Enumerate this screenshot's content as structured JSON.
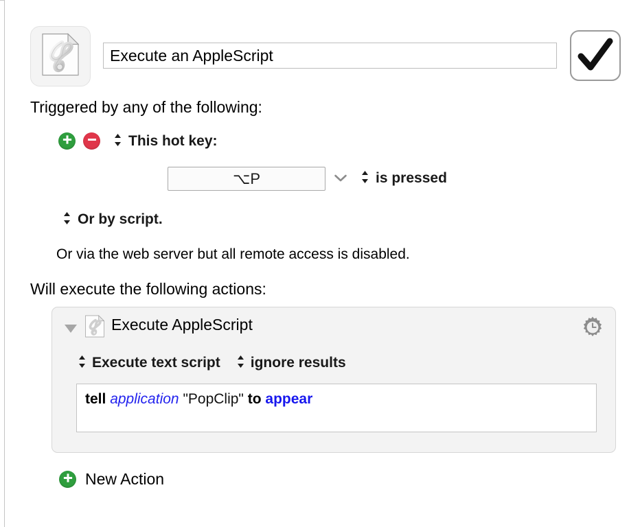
{
  "window": {
    "macro_title": "Execute an AppleScript",
    "macro_title_placeholder": "Macro Name",
    "macro_icon": "applescript-document-icon",
    "enabled_checkbox": "checkmark-icon",
    "enabled_checked": true
  },
  "triggers": {
    "heading": "Triggered by any of the following:",
    "add_button": "add-trigger-button",
    "remove_button": "remove-trigger-button",
    "hot_key_label": "This hot key:",
    "hot_key_value": "⌥P",
    "hot_key_placeholder": "Hot Key",
    "hot_key_dropdown": "chevron-down-icon",
    "pressed_label": "is pressed",
    "or_by_script_label": "Or by script.",
    "web_server_note": "Or via the web server but all remote access is disabled."
  },
  "actions": {
    "heading": "Will execute the following actions:",
    "items": [
      {
        "disclosure": "disclosure-triangle-open",
        "icon": "applescript-document-icon",
        "title": "Execute AppleScript",
        "gear": "gear-clock-icon",
        "source_option": "Execute text script",
        "results_option": "ignore results",
        "script_tokens": [
          {
            "type": "keyword",
            "text": "tell"
          },
          {
            "type": "space",
            "text": " "
          },
          {
            "type": "class",
            "text": "application"
          },
          {
            "type": "space",
            "text": " "
          },
          {
            "type": "string",
            "text": "\"PopClip\""
          },
          {
            "type": "space",
            "text": " "
          },
          {
            "type": "keyword",
            "text": "to"
          },
          {
            "type": "space",
            "text": " "
          },
          {
            "type": "command",
            "text": "appear"
          }
        ],
        "script_plain": "tell application \"PopClip\" to appear"
      }
    ],
    "new_action_label": "New Action",
    "new_action_button": "add-action-button"
  },
  "colors": {
    "add_green": "#2f9e3e",
    "remove_red": "#e0364a",
    "panel_bg": "#f3f3f3",
    "keyword": "#000000",
    "class_token": "#2222ee",
    "command_token": "#1717ee",
    "gear_gray": "#8c8c8c"
  }
}
